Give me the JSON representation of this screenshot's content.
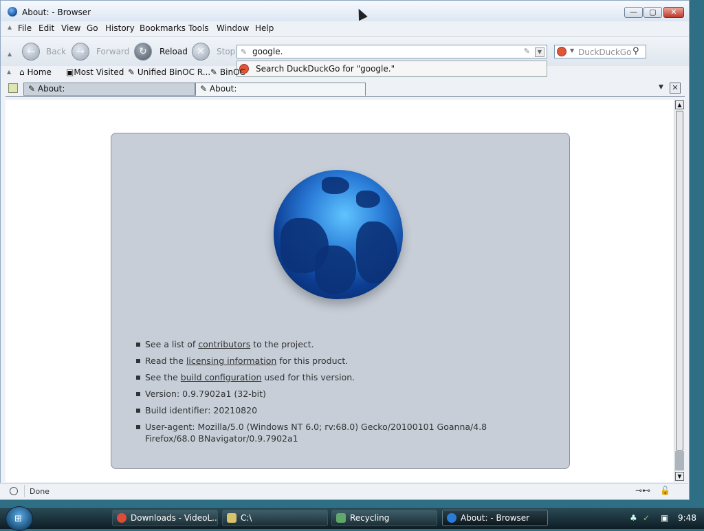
{
  "window": {
    "title": "About: - Browser"
  },
  "window_buttons": {
    "minimize": "—",
    "maximize": "▢",
    "close": "✕"
  },
  "menu": [
    "File",
    "Edit",
    "View",
    "Go",
    "History",
    "Bookmarks",
    "Tools",
    "Window",
    "Help"
  ],
  "nav": {
    "back_label": "Back",
    "forward_label": "Forward",
    "reload_label": "Reload",
    "stop_label": "Stop"
  },
  "urlbar": {
    "value": "google."
  },
  "search": {
    "placeholder": "DuckDuckGo"
  },
  "autocomplete": {
    "text": "Search DuckDuckGo for \"google.\""
  },
  "bookmarks": [
    {
      "label": "Home"
    },
    {
      "label": "Most Visited"
    },
    {
      "label": "Unified BinOC R..."
    },
    {
      "label": "BinOC"
    }
  ],
  "tabs": [
    {
      "label": "About:"
    },
    {
      "label": "About:"
    }
  ],
  "about": {
    "items": [
      {
        "prefix": "See a list of ",
        "link": "contributors",
        "suffix": " to the project."
      },
      {
        "prefix": "Read the ",
        "link": "licensing information",
        "suffix": " for this product."
      },
      {
        "prefix": "See the ",
        "link": "build configuration",
        "suffix": " used for this version."
      }
    ],
    "version": "Version: 0.9.7902a1 (32-bit)",
    "build_id": "Build identifier: 20210820",
    "user_agent": "User-agent: Mozilla/5.0 (Windows NT 6.0; rv:68.0) Gecko/20100101 Goanna/4.8 Firefox/68.0 BNavigator/0.9.7902a1"
  },
  "status": {
    "text": "Done"
  },
  "taskbar": {
    "tasks": [
      {
        "label": "Downloads - VideoL...",
        "color": "#dd4b39"
      },
      {
        "label": "C:\\",
        "color": "#d9c36a"
      },
      {
        "label": "Recycling",
        "color": "#5fa86a"
      },
      {
        "label": "About: - Browser",
        "color": "#2a7cd8"
      }
    ],
    "clock": "9:48"
  }
}
